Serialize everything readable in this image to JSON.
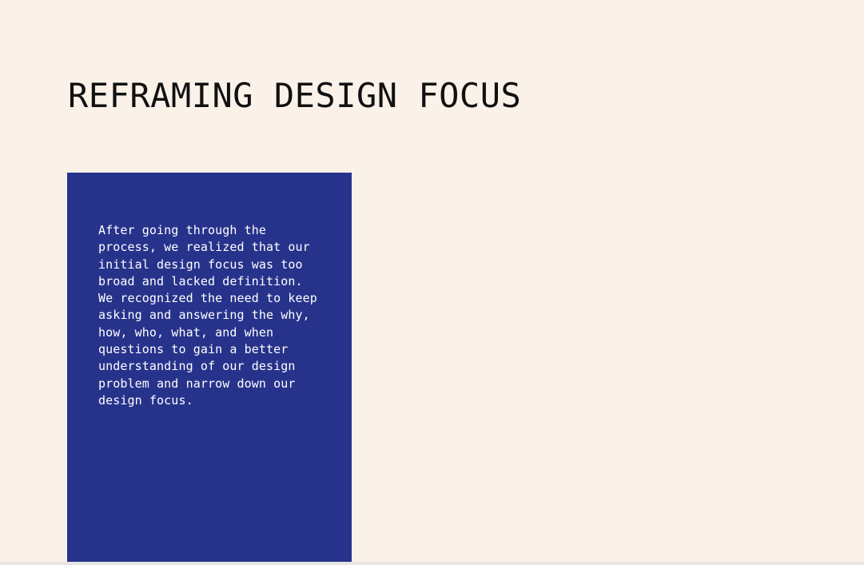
{
  "page": {
    "title": "REFRAMING DESIGN FOCUS",
    "background_color": "#faf2e9"
  },
  "card": {
    "background_color": "#27338b",
    "text": "After going through the\nprocess, we realized that our\ninitial design focus was too\nbroad and lacked definition.\nWe recognized the need to keep\nasking and answering the why,\nhow, who, what, and when\nquestions to gain a better\nunderstanding of our design\nproblem and narrow down our\ndesign focus."
  }
}
